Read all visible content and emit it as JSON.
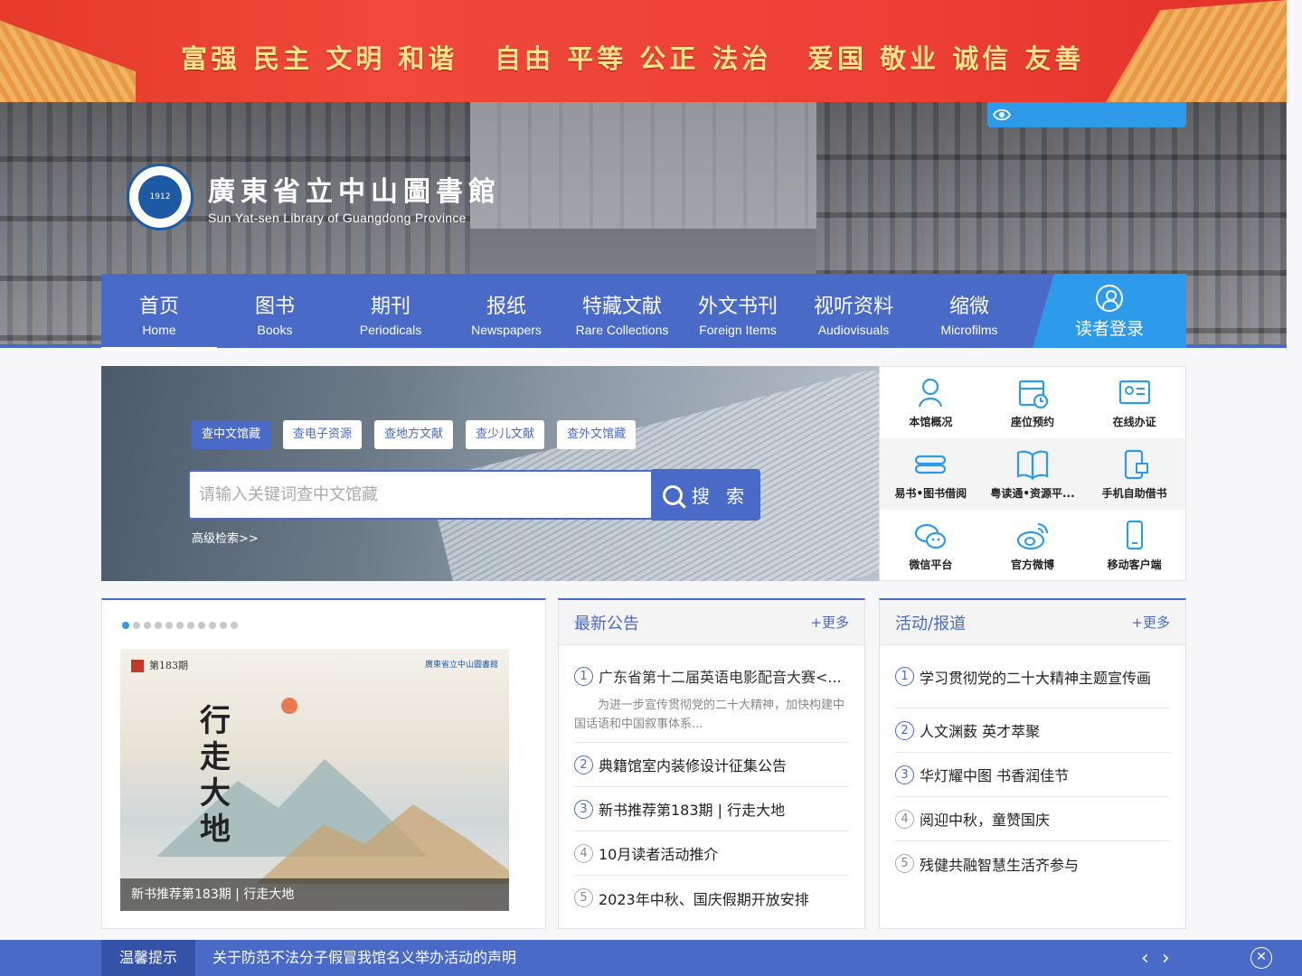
{
  "banner": {
    "slogans": [
      "富强 民主 文明 和谐",
      "自由 平等 公正 法治",
      "爱国 敬业 诚信 友善"
    ],
    "text_color": "#fbe48a",
    "bg_color": "#ee3f35"
  },
  "header": {
    "logo_cn": "廣東省立中山圖書館",
    "logo_en": "Sun Yat-sen Library of Guangdong Province",
    "seal_year": "1912"
  },
  "nav": {
    "items": [
      {
        "cn": "首页",
        "en": "Home"
      },
      {
        "cn": "图书",
        "en": "Books"
      },
      {
        "cn": "期刊",
        "en": "Periodicals"
      },
      {
        "cn": "报纸",
        "en": "Newspapers"
      },
      {
        "cn": "特藏文献",
        "en": "Rare Collections"
      },
      {
        "cn": "外文书刊",
        "en": "Foreign Items"
      },
      {
        "cn": "视听资料",
        "en": "Audiovisuals"
      },
      {
        "cn": "缩微",
        "en": "Microfilms"
      }
    ],
    "login_label": "读者登录",
    "accent": "#4a6ac8",
    "login_color": "#2e9bea"
  },
  "search": {
    "tabs": [
      "查中文馆藏",
      "查电子资源",
      "查地方文献",
      "查少儿文献",
      "查外文馆藏"
    ],
    "placeholder": "请输入关键词查中文馆藏",
    "button_label": "搜 索",
    "advanced": "高级检索>>"
  },
  "quick_links": [
    {
      "label": "本馆概况",
      "icon": "person-icon"
    },
    {
      "label": "座位预约",
      "icon": "calendar-clock-icon"
    },
    {
      "label": "在线办证",
      "icon": "id-card-icon"
    },
    {
      "label": "易书•图书借阅",
      "icon": "books-icon"
    },
    {
      "label": "粤读通•资源平...",
      "icon": "open-book-icon"
    },
    {
      "label": "手机自助借书",
      "icon": "phone-scan-icon"
    },
    {
      "label": "微信平台",
      "icon": "wechat-icon"
    },
    {
      "label": "官方微博",
      "icon": "weibo-icon"
    },
    {
      "label": "移动客户端",
      "icon": "mobile-icon"
    }
  ],
  "feature": {
    "dots": 11,
    "active_dot": 0,
    "issue": "第183期",
    "vertical_title": "行走大地",
    "caption": "新书推荐第183期 | 行走大地"
  },
  "notices": {
    "title": "最新公告",
    "more": "+更多",
    "first": {
      "num": "1",
      "title": "广东省第十二届英语电影配音大赛<...",
      "desc": "为进一步宣传贯彻党的二十大精神，加快构建中国话语和中国叙事体系..."
    },
    "items": [
      {
        "num": "2",
        "title": "典籍馆室内装修设计征集公告"
      },
      {
        "num": "3",
        "title": "新书推荐第183期 | 行走大地"
      },
      {
        "num": "4",
        "title": "10月读者活动推介"
      },
      {
        "num": "5",
        "title": "2023年中秋、国庆假期开放安排"
      }
    ]
  },
  "news": {
    "title": "活动/报道",
    "more": "+更多",
    "items": [
      {
        "num": "1",
        "title": "学习贯彻党的二十大精神主题宣传画"
      },
      {
        "num": "2",
        "title": "人文渊薮 英才萃聚"
      },
      {
        "num": "3",
        "title": "华灯耀中图 书香润佳节"
      },
      {
        "num": "4",
        "title": "阅迎中秋，童赞国庆"
      },
      {
        "num": "5",
        "title": "残健共融智慧生活齐参与"
      }
    ]
  },
  "tip_bar": {
    "label": "温馨提示",
    "text": "关于防范不法分子假冒我馆名义举办活动的声明"
  }
}
